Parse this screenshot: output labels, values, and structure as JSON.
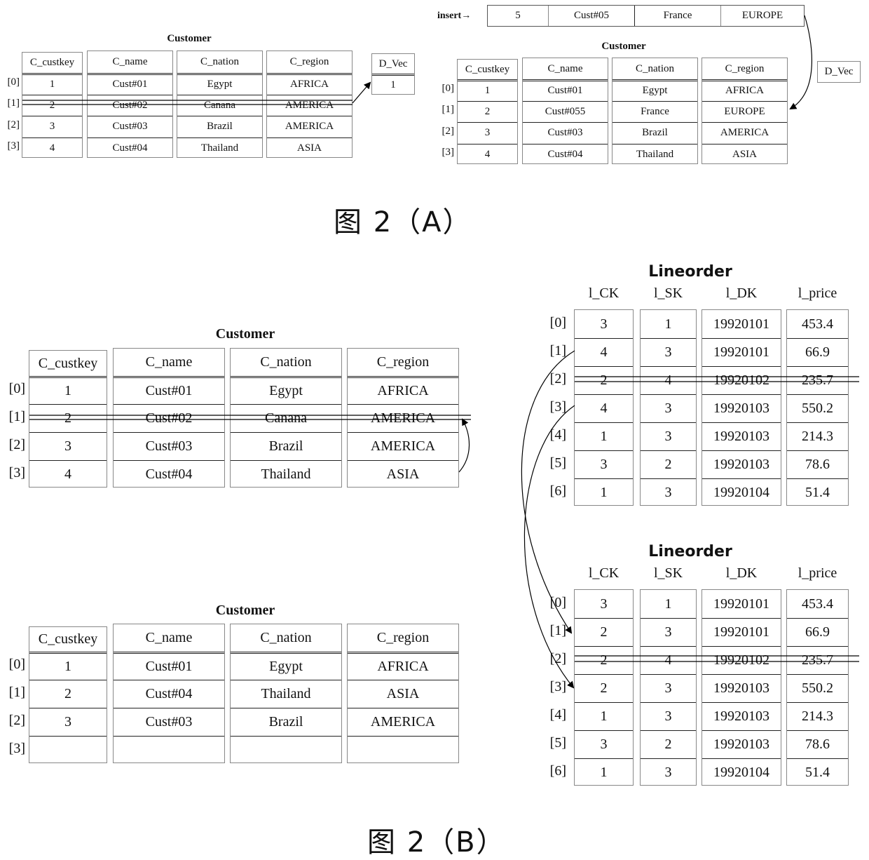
{
  "figure_a": {
    "caption": "图    2（A）",
    "left": {
      "title": "Customer",
      "columns": [
        "C_custkey",
        "C_name",
        "C_nation",
        "C_region"
      ],
      "indices": [
        "[0]",
        "[1]",
        "[2]",
        "[3]"
      ],
      "rows": [
        [
          "1",
          "Cust#01",
          "Egypt",
          "AFRICA"
        ],
        [
          "2",
          "Cust#02",
          "Canana",
          "AMERICA"
        ],
        [
          "3",
          "Cust#03",
          "Brazil",
          "AMERICA"
        ],
        [
          "4",
          "Cust#04",
          "Thailand",
          "ASIA"
        ]
      ],
      "deleted_row_index": 1,
      "dvec": {
        "header": "D_Vec",
        "values": [
          "1"
        ]
      }
    },
    "insert": {
      "label": "insert→",
      "values": [
        "5",
        "Cust#05",
        "France",
        "EUROPE"
      ]
    },
    "right": {
      "title": "Customer",
      "columns": [
        "C_custkey",
        "C_name",
        "C_nation",
        "C_region"
      ],
      "indices": [
        "[0]",
        "[1]",
        "[2]",
        "[3]"
      ],
      "rows": [
        [
          "1",
          "Cust#01",
          "Egypt",
          "AFRICA"
        ],
        [
          "2",
          "Cust#055",
          "France",
          "EUROPE"
        ],
        [
          "3",
          "Cust#03",
          "Brazil",
          "AMERICA"
        ],
        [
          "4",
          "Cust#04",
          "Thailand",
          "ASIA"
        ]
      ],
      "dvec": {
        "header": "D_Vec"
      }
    }
  },
  "figure_b": {
    "caption": "图    2（B）",
    "customer_before": {
      "title": "Customer",
      "columns": [
        "C_custkey",
        "C_name",
        "C_nation",
        "C_region"
      ],
      "indices": [
        "[0]",
        "[1]",
        "[2]",
        "[3]"
      ],
      "rows": [
        [
          "1",
          "Cust#01",
          "Egypt",
          "AFRICA"
        ],
        [
          "2",
          "Cust#02",
          "Canana",
          "AMERICA"
        ],
        [
          "3",
          "Cust#03",
          "Brazil",
          "AMERICA"
        ],
        [
          "4",
          "Cust#04",
          "Thailand",
          "ASIA"
        ]
      ],
      "deleted_row_index": 1
    },
    "customer_after": {
      "title": "Customer",
      "columns": [
        "C_custkey",
        "C_name",
        "C_nation",
        "C_region"
      ],
      "indices": [
        "[0]",
        "[1]",
        "[2]",
        "[3]"
      ],
      "rows": [
        [
          "1",
          "Cust#01",
          "Egypt",
          "AFRICA"
        ],
        [
          "2",
          "Cust#04",
          "Thailand",
          "ASIA"
        ],
        [
          "3",
          "Cust#03",
          "Brazil",
          "AMERICA"
        ],
        [
          "",
          "",
          "",
          ""
        ]
      ]
    },
    "lineorder_before": {
      "title": "Lineorder",
      "columns": [
        "l_CK",
        "l_SK",
        "l_DK",
        "l_price"
      ],
      "indices": [
        "[0]",
        "[1]",
        "[2]",
        "[3]",
        "[4]",
        "[5]",
        "[6]"
      ],
      "rows": [
        [
          "3",
          "1",
          "19920101",
          "453.4"
        ],
        [
          "4",
          "3",
          "19920101",
          "66.9"
        ],
        [
          "2",
          "4",
          "19920102",
          "235.7"
        ],
        [
          "4",
          "3",
          "19920103",
          "550.2"
        ],
        [
          "1",
          "3",
          "19920103",
          "214.3"
        ],
        [
          "3",
          "2",
          "19920103",
          "78.6"
        ],
        [
          "1",
          "3",
          "19920104",
          "51.4"
        ]
      ],
      "deleted_row_index": 2
    },
    "lineorder_after": {
      "title": "Lineorder",
      "columns": [
        "l_CK",
        "l_SK",
        "l_DK",
        "l_price"
      ],
      "indices": [
        "[0]",
        "[1]",
        "[2]",
        "[3]",
        "[4]",
        "[5]",
        "[6]"
      ],
      "rows": [
        [
          "3",
          "1",
          "19920101",
          "453.4"
        ],
        [
          "2",
          "3",
          "19920101",
          "66.9"
        ],
        [
          "2",
          "4",
          "19920102",
          "235.7"
        ],
        [
          "2",
          "3",
          "19920103",
          "550.2"
        ],
        [
          "1",
          "3",
          "19920103",
          "214.3"
        ],
        [
          "3",
          "2",
          "19920103",
          "78.6"
        ],
        [
          "1",
          "3",
          "19920104",
          "51.4"
        ]
      ],
      "deleted_row_index": 2
    }
  }
}
